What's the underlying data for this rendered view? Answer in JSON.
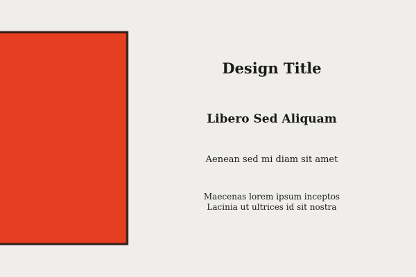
{
  "colors": {
    "background": "#efeeea",
    "block": "#e53e21",
    "block_border": "#2a1a16"
  },
  "title": "Design Title",
  "subtitle": "Libero Sed Aliquam",
  "tagline": "Aenean sed mi diam sit amet",
  "body_lines": [
    "Maecenas lorem ipsum inceptos",
    "Lacinia ut ultrices id sit nostra"
  ]
}
